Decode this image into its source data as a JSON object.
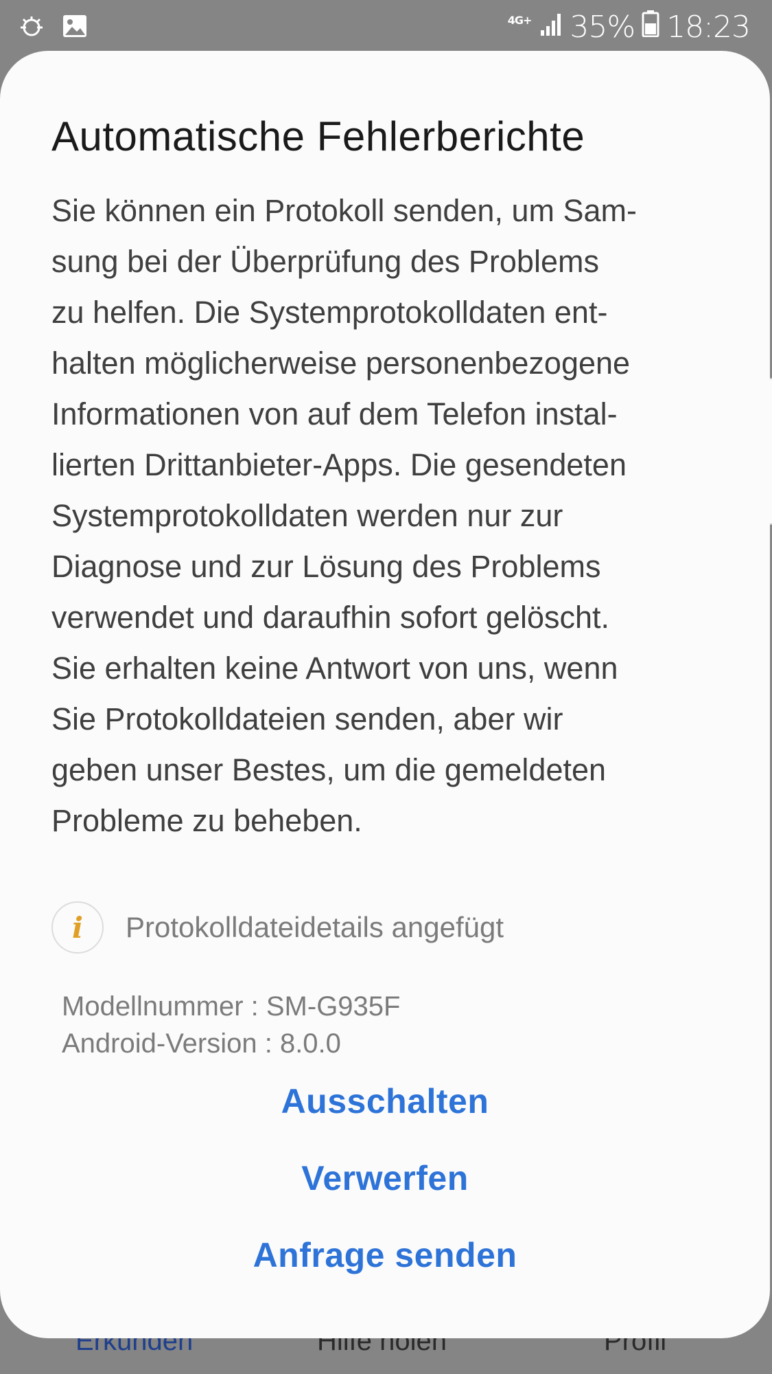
{
  "status_bar": {
    "network": "4G+",
    "battery": "35%",
    "time": "18:23"
  },
  "bottom_nav": {
    "items": [
      "Erkunden",
      "Hilfe holen",
      "Profil"
    ]
  },
  "dialog": {
    "title": "Automatische Fehlerberichte",
    "body": "Sie können ein Protokoll senden, um Sam-\nsung bei der Überprüfung des Problems\nzu helfen. Die Systemprotokolldaten ent-\nhalten möglicherweise personenbezogene\nInformationen von auf dem Telefon instal-\nlierten Drittanbieter-Apps. Die gesendeten\nSystemprotokolldaten werden nur zur\nDiagnose und zur Lösung des Problems\nverwendet und daraufhin sofort gelöscht.\nSie erhalten keine Antwort von uns, wenn\nSie Protokolldateien senden, aber wir\ngeben unser Bestes, um die gemeldeten\nProbleme zu beheben.",
    "attachment_icon": "i",
    "attachment_label": "Protokolldateidetails angefügt",
    "model_number": "Modellnummer : SM-G935F",
    "android_version": "Android-Version : 8.0.0",
    "buttons": {
      "turn_off": "Ausschalten",
      "discard": "Verwerfen",
      "send_request": "Anfrage senden"
    }
  },
  "colors": {
    "accent": "#2d73d8",
    "info_icon": "#e0a028",
    "dialog_bg": "#fbfbfb",
    "scrim": "#858585"
  },
  "icons": [
    "sync-icon",
    "image-icon",
    "signal-icon",
    "battery-icon",
    "info-icon"
  ]
}
